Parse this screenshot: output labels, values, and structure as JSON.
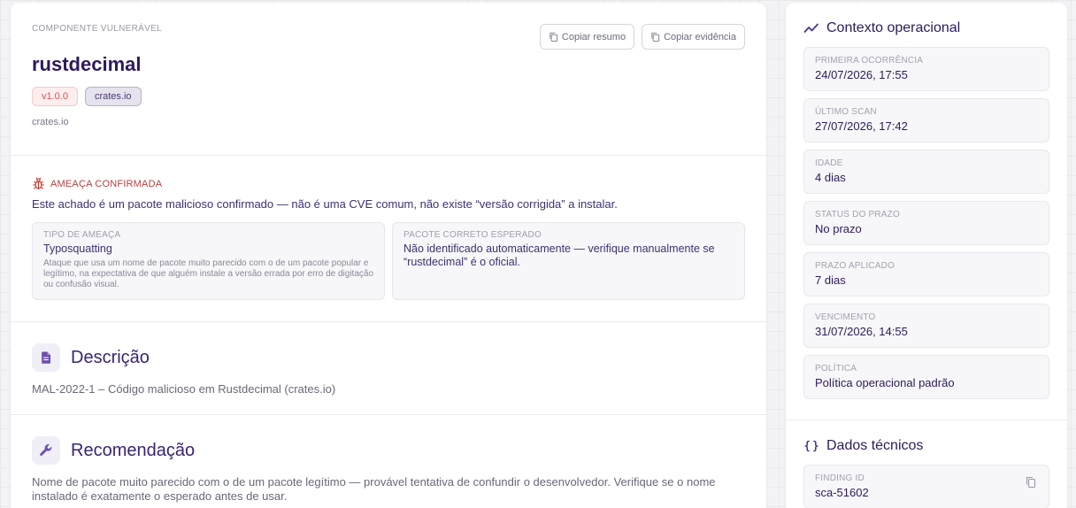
{
  "component": {
    "overline": "COMPONENTE VULNERÁVEL",
    "name": "rustdecimal",
    "version_badge": "v1.0.0",
    "registry_badge": "crates.io",
    "registry_line": "crates.io",
    "actions": {
      "copy_summary": "Copiar resumo",
      "copy_evidence": "Copiar evidência"
    }
  },
  "threat": {
    "label": "AMEAÇA CONFIRMADA",
    "text": "Este achado é um pacote malicioso confirmado — não é uma CVE comum, não existe “versão corrigida” a instalar.",
    "type_box": {
      "label": "TIPO DE AMEAÇA",
      "value": "Typosquatting",
      "note": "Ataque que usa um nome de pacote muito parecido com o de um pacote popular e legítimo, na expectativa de que alguém instale a versão errada por erro de digitação ou confusão visual."
    },
    "expected_box": {
      "label": "PACOTE CORRETO ESPERADO",
      "value": "Não identificado automaticamente — verifique manualmente se “rustdecimal” é o oficial."
    }
  },
  "description": {
    "title": "Descrição",
    "body": "MAL-2022-1 – Código malicioso em Rustdecimal (crates.io)"
  },
  "recommendation": {
    "title": "Recomendação",
    "body": "Nome de pacote muito parecido com o de um pacote legítimo — provável tentativa de confundir o desenvolvedor. Verifique se o nome instalado é exatamente o esperado antes de usar."
  },
  "operational": {
    "title": "Contexto operacional",
    "items": [
      {
        "label": "PRIMEIRA OCORRÊNCIA",
        "value": "24/07/2026, 17:55"
      },
      {
        "label": "ÚLTIMO SCAN",
        "value": "27/07/2026, 17:42"
      },
      {
        "label": "IDADE",
        "value": "4 dias"
      },
      {
        "label": "STATUS DO PRAZO",
        "value": "No prazo"
      },
      {
        "label": "PRAZO APLICADO",
        "value": "7 dias"
      },
      {
        "label": "VENCIMENTO",
        "value": "31/07/2026, 14:55"
      },
      {
        "label": "POLÍTICA",
        "value": "Política operacional padrão"
      }
    ]
  },
  "technical": {
    "title": "Dados técnicos",
    "finding_label": "FINDING ID",
    "finding_value": "sca-51602"
  },
  "icons": {
    "copy": "copy-icon",
    "bug": "bug-icon",
    "document": "document-icon",
    "wrench": "wrench-icon",
    "trend": "trend-icon",
    "braces": "braces-icon"
  },
  "colors": {
    "brand": "#2e1a5c",
    "accent": "#7c5cbf",
    "threat": "#b4413f"
  }
}
